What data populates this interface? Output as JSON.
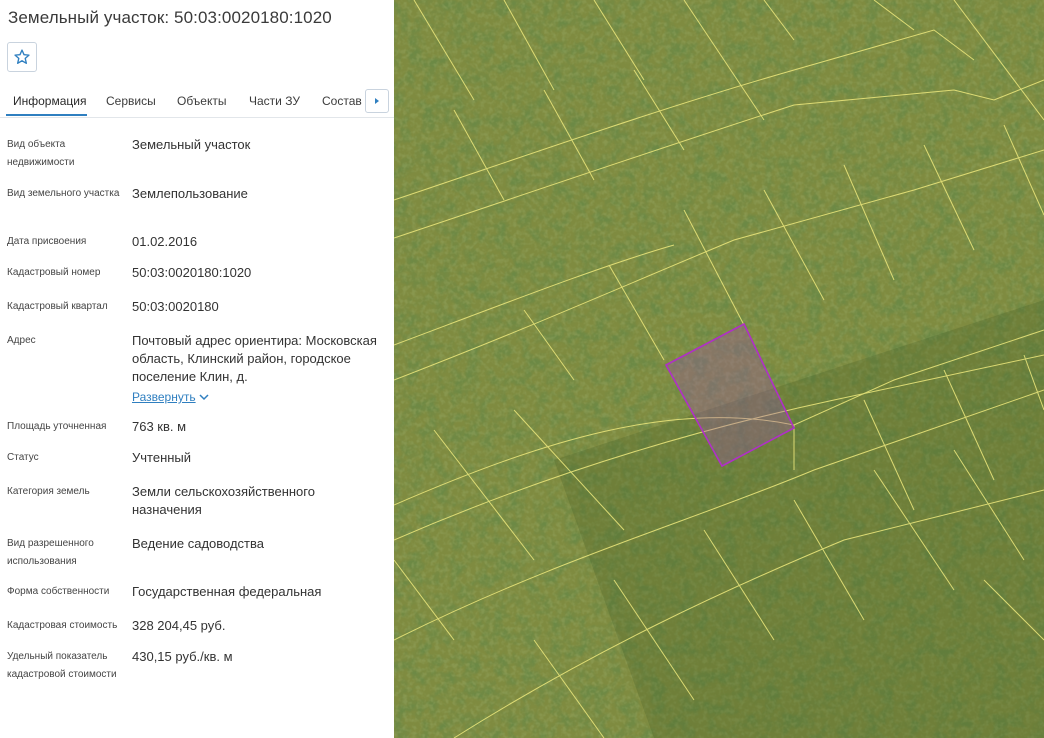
{
  "header": {
    "title": "Земельный участок: 50:03:0020180:1020"
  },
  "tabs": [
    "Информация",
    "Сервисы",
    "Объекты",
    "Части ЗУ",
    "Состав ЕЗП"
  ],
  "details": [
    {
      "label": "Вид объекта недвижимости",
      "value": "Земельный участок"
    },
    {
      "label": "Вид земельного участка",
      "value": "Землепользование"
    },
    {
      "label": "Дата присвоения",
      "value": "01.02.2016"
    },
    {
      "label": "Кадастровый номер",
      "value": "50:03:0020180:1020"
    },
    {
      "label": "Кадастровый квартал",
      "value": "50:03:0020180"
    },
    {
      "label": "Адрес",
      "value": "Почтовый адрес ориентира: Московская область, Клинский район, городское поселение Клин, д."
    },
    {
      "label": "Площадь уточненная",
      "value": "763 кв. м"
    },
    {
      "label": "Статус",
      "value": "Учтенный"
    },
    {
      "label": "Категория земель",
      "value": "Земли сельскохозяйственного назначения"
    },
    {
      "label": "Вид разрешенного использования",
      "value": "Ведение садоводства"
    },
    {
      "label": "Форма собственности",
      "value": "Государственная федеральная"
    },
    {
      "label": "Кадастровая стоимость",
      "value": "328 204,45 руб."
    },
    {
      "label": "Удельный показатель кадастровой стоимости",
      "value": "430,15 руб./кв. м"
    }
  ],
  "address_expand": "Развернуть",
  "colors": {
    "accent": "#2f7fc0",
    "map_base": "#7d8a3f",
    "parcel_boundary": "#e8e47a",
    "selected_parcel": "#a43cc0"
  },
  "icons": {
    "favorite": "star-icon",
    "tabs_next": "caret-right-icon",
    "expand": "chevron-down-icon"
  }
}
